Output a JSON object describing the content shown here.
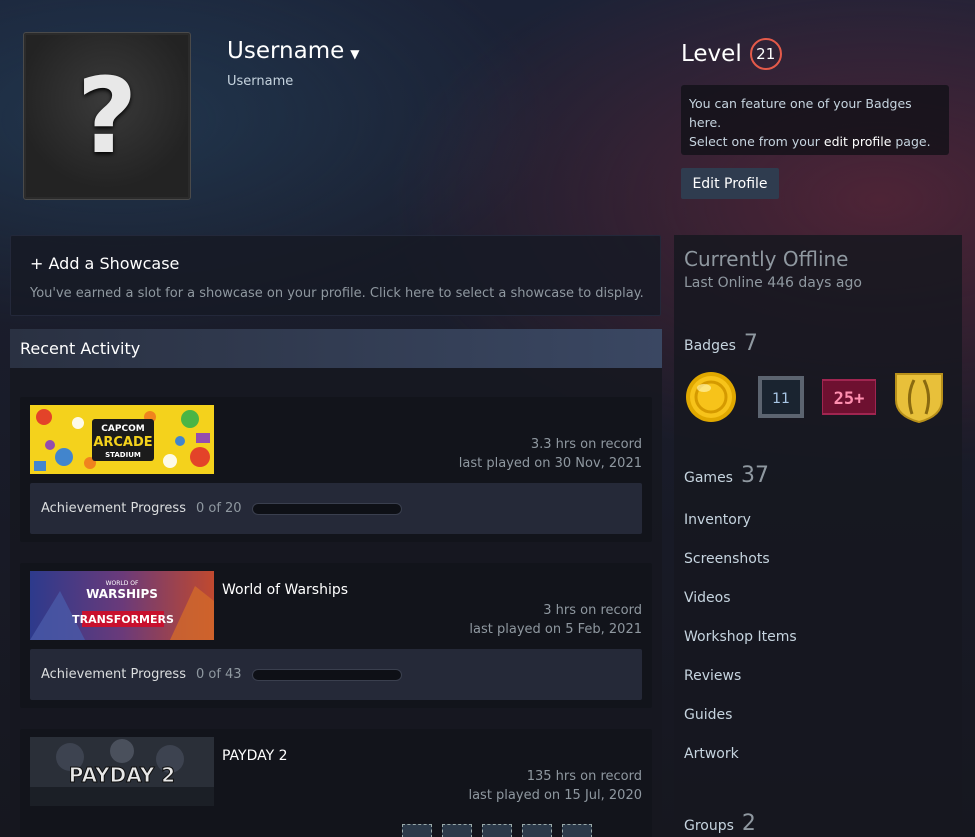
{
  "header": {
    "persona_name": "Username",
    "real_name": "Username",
    "level_label": "Level",
    "level_value": "21",
    "feature_text_1": "You can feature one of your Badges here.",
    "feature_text_2": "Select one from your ",
    "feature_link": "edit profile",
    "feature_text_3": " page.",
    "edit_profile_label": "Edit Profile",
    "avatar_glyph": "?"
  },
  "showcase": {
    "title": "+ Add a Showcase",
    "description": "You've earned a slot for a showcase on your profile. Click here to select a showcase to display."
  },
  "activity": {
    "title": "Recent Activity",
    "games": [
      {
        "name": "",
        "hours": "3.3 hrs on record",
        "last_played": "last played on 30 Nov, 2021",
        "achievement_label": "Achievement Progress",
        "achievement_count": "0 of 20",
        "achievement_progress": 0
      },
      {
        "name": "World of Warships",
        "hours": "3 hrs on record",
        "last_played": "last played on 5 Feb, 2021",
        "achievement_label": "Achievement Progress",
        "achievement_count": "0 of 43",
        "achievement_progress": 0
      },
      {
        "name": "PAYDAY 2",
        "hours": "135 hrs on record",
        "last_played": "last played on 15 Jul, 2020"
      }
    ],
    "capsules": {
      "capcom_1": "CAPCOM",
      "capcom_2": "ARCADE",
      "capcom_3": "STADIUM",
      "wows_1": "WORLD OF",
      "wows_2": "WARSHIPS",
      "wows_3": "TRANSFORMERS",
      "payday": "PAYDAY 2"
    }
  },
  "sidebar": {
    "status": "Currently Offline",
    "last_online": "Last Online 446 days ago",
    "badges_label": "Badges",
    "badges_count": "7",
    "badges": [
      {
        "icon": "gold-coin-badge-icon"
      },
      {
        "icon": "years-of-service-badge-icon",
        "text": "11"
      },
      {
        "icon": "games-owned-badge-icon",
        "text": "25+"
      },
      {
        "icon": "laurel-shield-badge-icon"
      }
    ],
    "games_label": "Games",
    "games_count": "37",
    "links": [
      "Inventory",
      "Screenshots",
      "Videos",
      "Workshop Items",
      "Reviews",
      "Guides",
      "Artwork"
    ],
    "groups_label": "Groups",
    "groups_count": "2"
  },
  "colors": {
    "accent_level": "#e45a4a",
    "button_bg": "#2f3c4f"
  }
}
